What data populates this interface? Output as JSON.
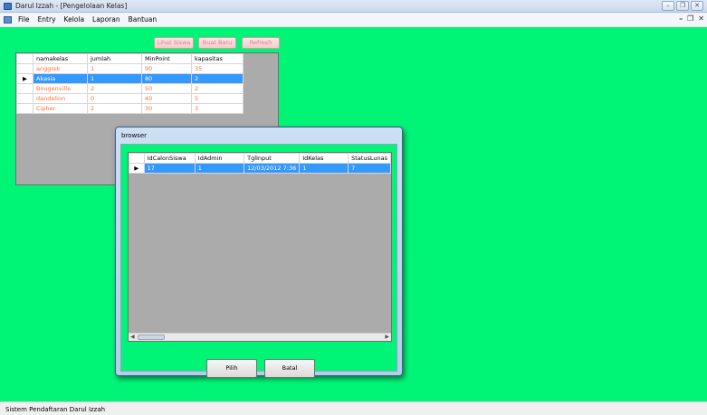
{
  "window": {
    "title": "Darul Izzah - [Pengelolaan Kelas]"
  },
  "menu": [
    "File",
    "Entry",
    "Kelola",
    "Laporan",
    "Bantuan"
  ],
  "toolbar": {
    "lihat_label": "Lihat Siswa",
    "buat_label": "Buat Baru",
    "refresh_label": "Refresh"
  },
  "main_grid": {
    "columns": [
      "namakelas",
      "jumlah",
      "MinPoint",
      "kapasitas"
    ],
    "rows": [
      [
        "anggrek",
        "1",
        "90",
        "35"
      ],
      [
        "Akasia",
        "1",
        "80",
        "2"
      ],
      [
        "Bougenville",
        "2",
        "50",
        "2"
      ],
      [
        "dandelion",
        "0",
        "40",
        "5"
      ],
      [
        "Cipher",
        "2",
        "30",
        "3"
      ]
    ],
    "selected_row": 1
  },
  "dialog": {
    "title": "browser",
    "columns": [
      "IdCalonSiswa",
      "IdAdmin",
      "TglInput",
      "IdKelas",
      "StatusLunas"
    ],
    "rows": [
      [
        "17",
        "1",
        "12/03/2012 7:36",
        "1",
        "7"
      ]
    ],
    "pilih_label": "Pilih",
    "batal_label": "Batal"
  },
  "status": {
    "text": "Sistem Pendaftaran Darul Izzah"
  },
  "colors": {
    "client_bg": "#00f577",
    "selection": "#3399ff",
    "cell_text": "#ff6f3c"
  }
}
